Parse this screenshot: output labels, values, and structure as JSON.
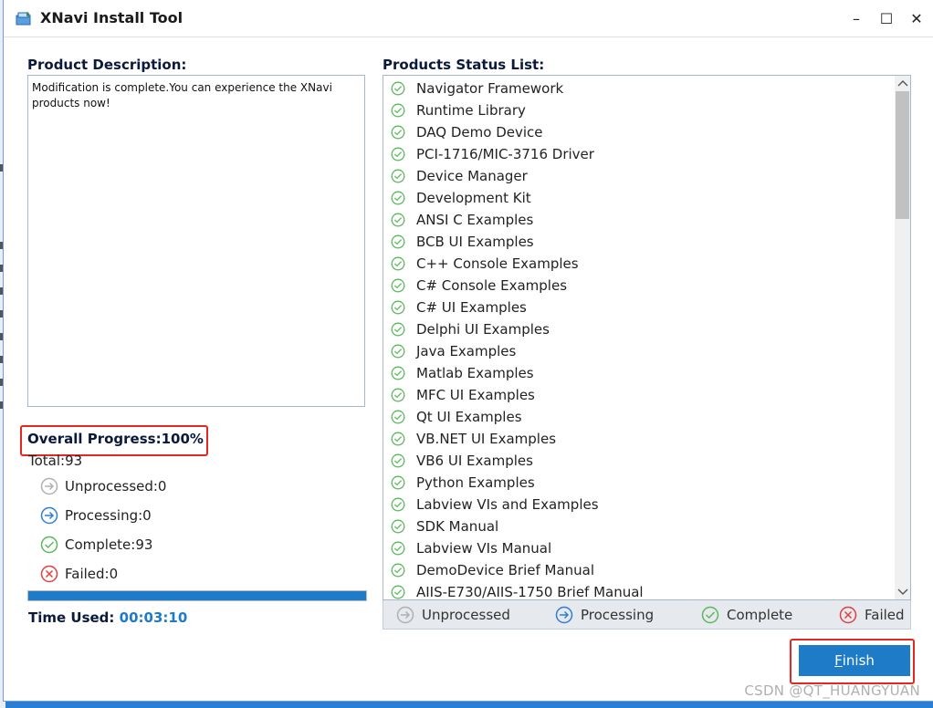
{
  "window": {
    "title": "XNavi Install Tool",
    "controls": {
      "minimize": "–",
      "maximize": "☐",
      "close": "✕"
    }
  },
  "description": {
    "label": "Product Description:",
    "text": "Modification is complete.You can experience the XNavi products now!"
  },
  "progress": {
    "label": "Overall Progress:100%",
    "percent": 100,
    "total": "Total:93",
    "unprocessed": "Unprocessed:0",
    "processing": "Processing:0",
    "complete": "Complete:93",
    "failed": "Failed:0",
    "time_label": "Time Used:",
    "time_value": "00:03:10"
  },
  "status_list": {
    "label": "Products Status List:",
    "items": [
      "Navigator Framework",
      "Runtime Library",
      "DAQ Demo Device",
      "PCI-1716/MIC-3716 Driver",
      "Device Manager",
      "Development Kit",
      "ANSI C Examples",
      "BCB UI Examples",
      "C++ Console Examples",
      "C# Console Examples",
      "C# UI Examples",
      "Delphi UI Examples",
      "Java Examples",
      "Matlab Examples",
      "MFC UI Examples",
      "Qt UI Examples",
      "VB.NET UI Examples",
      "VB6 UI Examples",
      "Python Examples",
      "Labview VIs and Examples",
      "SDK Manual",
      "Labview VIs Manual",
      "DemoDevice Brief Manual",
      "AIIS-E730/AIIS-1750 Brief Manual"
    ]
  },
  "legend": {
    "unprocessed": "Unprocessed",
    "processing": "Processing",
    "complete": "Complete",
    "failed": "Failed"
  },
  "finish_button": {
    "mnemonic": "F",
    "rest": "inish"
  },
  "watermark": "CSDN @QT_HUANGYUAN",
  "colors": {
    "accent": "#1e7bc8",
    "complete": "#5cb85c",
    "failed": "#e04040",
    "processing": "#2f7fd0",
    "unprocessed": "#b0b0b0",
    "highlight": "#e6271f"
  },
  "icons": {
    "app": "installer-icon",
    "complete": "check-circle-icon",
    "processing": "arrow-right-circle-icon",
    "unprocessed": "arrow-right-circle-gray-icon",
    "failed": "x-circle-icon"
  }
}
